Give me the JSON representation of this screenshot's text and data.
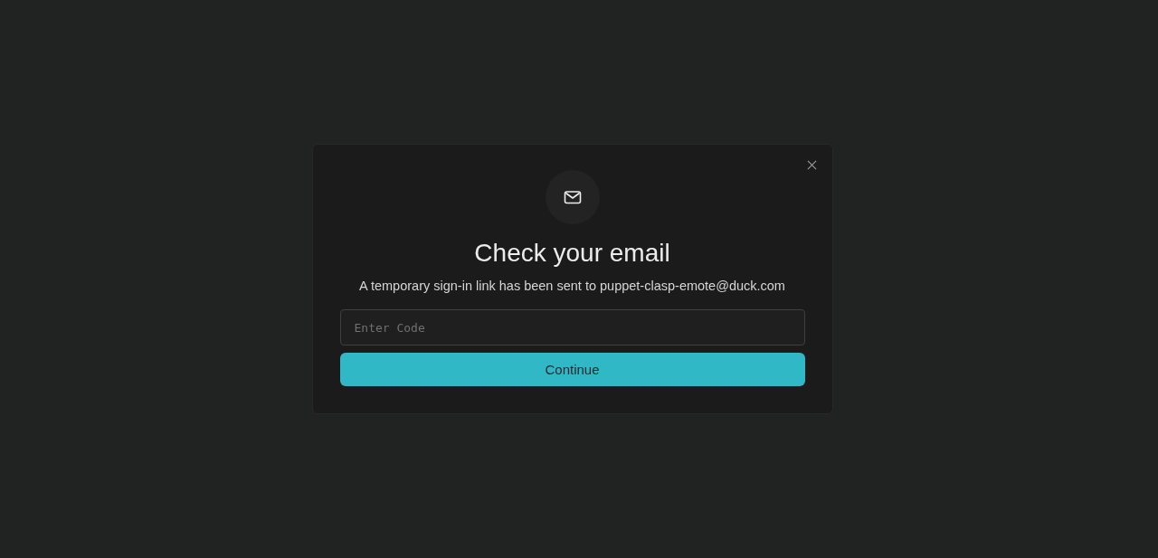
{
  "dialog": {
    "title": "Check your email",
    "message": "A temporary sign-in link has been sent to puppet-clasp-emote@duck.com",
    "code_field": {
      "placeholder": "Enter Code"
    },
    "continue_button": {
      "label": "Continue"
    }
  }
}
